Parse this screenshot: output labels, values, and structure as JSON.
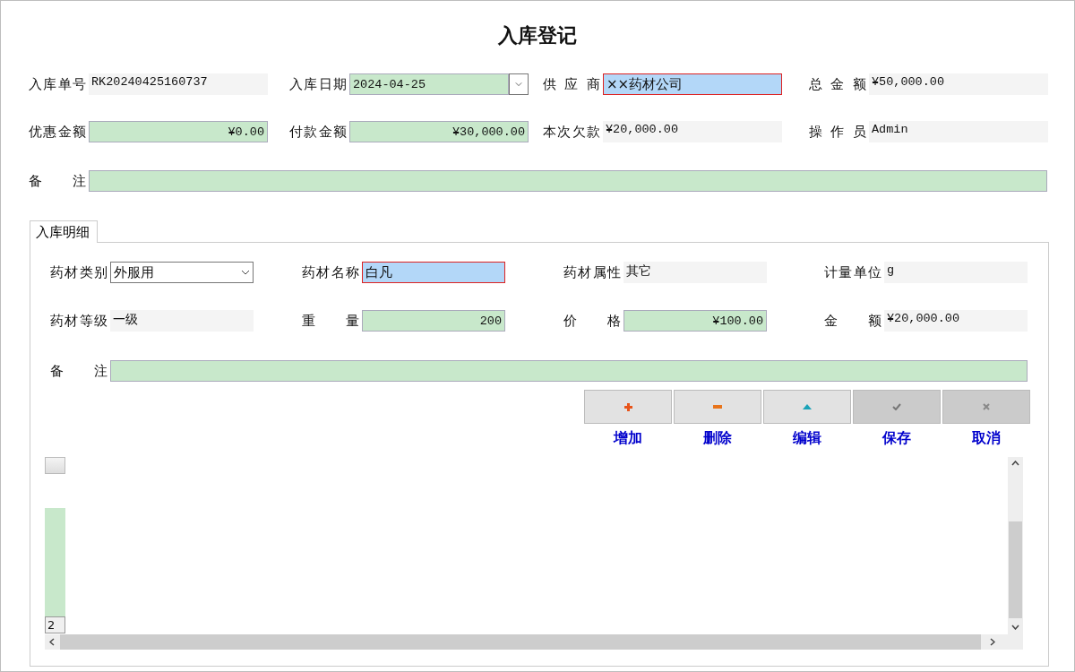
{
  "window": {
    "title": "入库登记"
  },
  "header_fields": [
    {
      "label": "入库单号",
      "value": "RK20240425160737",
      "kind": "readonly"
    },
    {
      "label": "入库日期",
      "value": "2024-04-25",
      "kind": "date"
    },
    {
      "label": "供 应 商",
      "value": "××药材公司",
      "kind": "highlighted"
    },
    {
      "label": "总 金 额",
      "value": "¥50,000.00",
      "kind": "readonly"
    },
    {
      "label": "优惠金额",
      "value": "¥0.00",
      "kind": "number"
    },
    {
      "label": "付款金额",
      "value": "¥30,000.00",
      "kind": "number"
    },
    {
      "label": "本次欠款",
      "value": "¥20,000.00",
      "kind": "readonly"
    },
    {
      "label": "操 作 员",
      "value": "Admin",
      "kind": "readonly"
    }
  ],
  "header_remark": {
    "label": "备 注"
  },
  "tabs": [
    {
      "label": "入库明细",
      "selected": true
    }
  ],
  "detail_fields": [
    {
      "label": "药材类别",
      "value": "外服用",
      "kind": "dropdown"
    },
    {
      "label": "药材名称",
      "value": "白凡",
      "kind": "highlighted"
    },
    {
      "label": "药材属性",
      "value": "其它",
      "kind": "readonly"
    },
    {
      "label": "计量单位",
      "value": "g",
      "kind": "readonly"
    },
    {
      "label": "药材等级",
      "value": "一级",
      "kind": "readonly"
    },
    {
      "label": "重 量",
      "value": "200",
      "kind": "number"
    },
    {
      "label": "价 格",
      "value": "¥100.00",
      "kind": "number"
    },
    {
      "label": "金 额",
      "value": "¥20,000.00",
      "kind": "readonly"
    }
  ],
  "detail_remark": {
    "label": "备 注"
  },
  "buttons": [
    {
      "label": "增加",
      "kind": "plus",
      "disabled": false
    },
    {
      "label": "删除",
      "kind": "minus",
      "disabled": false
    },
    {
      "label": "编辑",
      "kind": "up",
      "disabled": false
    },
    {
      "label": "保存",
      "kind": "check",
      "disabled": true
    },
    {
      "label": "取消",
      "kind": "cross",
      "disabled": true
    }
  ],
  "grid": {
    "row_label": "2"
  }
}
